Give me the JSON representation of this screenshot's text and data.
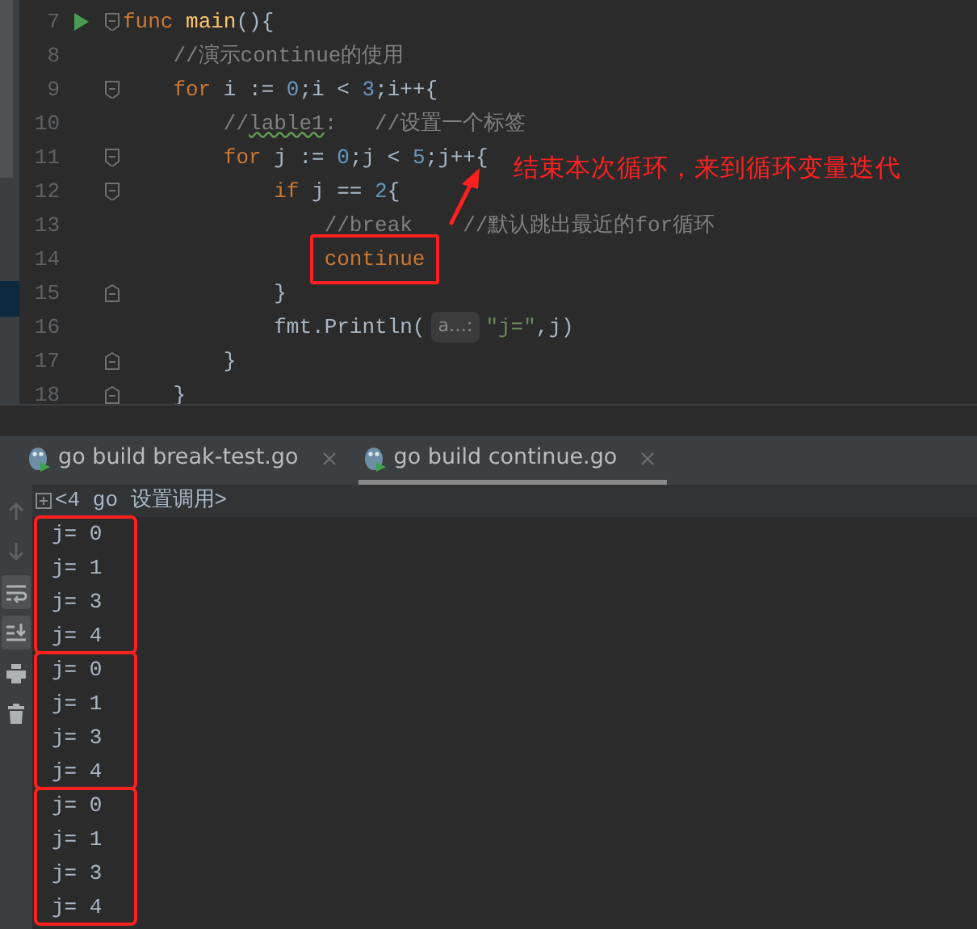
{
  "editor": {
    "lines": [
      {
        "number": "7",
        "run": true,
        "fold_start": true,
        "fold_end": false,
        "boxed": false,
        "tokens": [
          {
            "kind": "kw",
            "text": "func"
          },
          {
            "kind": "fn",
            "text": " main"
          },
          {
            "kind": "plain",
            "text": "(){"
          }
        ],
        "children": [
          {
            "number": "8",
            "run": false,
            "fold_start": false,
            "fold_end": false,
            "boxed": false,
            "tokens": [
              {
                "kind": "comment",
                "text": "//演示continue的使用"
              }
            ]
          },
          {
            "number": "9",
            "run": false,
            "fold_start": true,
            "fold_end": false,
            "boxed": false,
            "tokens": [
              {
                "kind": "kw",
                "text": "for"
              },
              {
                "kind": "plain",
                "text": " i := "
              },
              {
                "kind": "num",
                "text": "0"
              },
              {
                "kind": "plain",
                "text": ";i < "
              },
              {
                "kind": "num",
                "text": "3"
              },
              {
                "kind": "plain",
                "text": ";i++{"
              }
            ],
            "children": [
              {
                "number": "10",
                "run": false,
                "fold_start": false,
                "fold_end": false,
                "boxed": false,
                "tokens": [
                  {
                    "kind": "comment",
                    "text": "//"
                  },
                  {
                    "kind": "typo",
                    "text": "lable1"
                  },
                  {
                    "kind": "comment",
                    "text": ":   //设置一个标签"
                  }
                ]
              },
              {
                "number": "11",
                "run": false,
                "fold_start": true,
                "fold_end": false,
                "boxed": false,
                "tokens": [
                  {
                    "kind": "kw",
                    "text": "for"
                  },
                  {
                    "kind": "plain",
                    "text": " j := "
                  },
                  {
                    "kind": "num",
                    "text": "0"
                  },
                  {
                    "kind": "plain",
                    "text": ";j < "
                  },
                  {
                    "kind": "num",
                    "text": "5"
                  },
                  {
                    "kind": "plain",
                    "text": ";j++{"
                  }
                ],
                "children": [
                  {
                    "number": "12",
                    "run": false,
                    "fold_start": true,
                    "fold_end": false,
                    "boxed": false,
                    "tokens": [
                      {
                        "kind": "kw",
                        "text": "if"
                      },
                      {
                        "kind": "plain",
                        "text": " j == "
                      },
                      {
                        "kind": "num",
                        "text": "2"
                      },
                      {
                        "kind": "plain",
                        "text": "{"
                      }
                    ],
                    "children": [
                      {
                        "number": "13",
                        "run": false,
                        "fold_start": false,
                        "fold_end": false,
                        "boxed": false,
                        "tokens": [
                          {
                            "kind": "comment",
                            "text": "//break    //默认跳出最近的for循环"
                          }
                        ]
                      },
                      {
                        "number": "14",
                        "run": false,
                        "fold_start": false,
                        "fold_end": false,
                        "boxed": true,
                        "tokens": [
                          {
                            "kind": "kw",
                            "text": "continue"
                          }
                        ]
                      }
                    ]
                  },
                  {
                    "number": "15",
                    "run": false,
                    "fold_start": false,
                    "fold_end": true,
                    "boxed": false,
                    "tokens": [
                      {
                        "kind": "plain",
                        "text": "}"
                      }
                    ]
                  },
                  {
                    "number": "16",
                    "run": false,
                    "fold_start": false,
                    "fold_end": false,
                    "boxed": false,
                    "tokens": [
                      {
                        "kind": "plain",
                        "text": "fmt.Println("
                      },
                      {
                        "kind": "hint",
                        "text": "a…:"
                      },
                      {
                        "kind": "str",
                        "text": "\"j=\""
                      },
                      {
                        "kind": "plain",
                        "text": ",j)"
                      }
                    ]
                  }
                ]
              },
              {
                "number": "17",
                "run": false,
                "fold_start": false,
                "fold_end": true,
                "boxed": false,
                "tokens": [
                  {
                    "kind": "plain",
                    "text": "}"
                  }
                ]
              }
            ]
          },
          {
            "number": "18",
            "run": false,
            "fold_start": false,
            "fold_end": true,
            "boxed": false,
            "tokens": [
              {
                "kind": "plain",
                "text": "}"
              }
            ]
          }
        ]
      }
    ]
  },
  "annotation": {
    "text": "结束本次循环，来到循环变量迭代"
  },
  "run_tabs": [
    {
      "label": "go build break-test.go",
      "selected": false
    },
    {
      "label": "go build continue.go",
      "selected": true
    }
  ],
  "console": {
    "toolbar": [
      {
        "kind": "up",
        "disabled": true,
        "selected": false
      },
      {
        "kind": "down",
        "disabled": true,
        "selected": false
      },
      {
        "kind": "wrap",
        "disabled": false,
        "selected": true
      },
      {
        "kind": "scroll",
        "disabled": false,
        "selected": true
      },
      {
        "kind": "print",
        "disabled": false,
        "selected": false
      },
      {
        "kind": "trash",
        "disabled": false,
        "selected": false
      }
    ],
    "header": "<4 go 设置调用>",
    "groups": [
      {
        "boxed": true,
        "lines": [
          "j= 0",
          "j= 1",
          "j= 3",
          "j= 4"
        ]
      },
      {
        "boxed": true,
        "lines": [
          "j= 0",
          "j= 1",
          "j= 3",
          "j= 4"
        ]
      },
      {
        "boxed": true,
        "lines": [
          "j= 0",
          "j= 1",
          "j= 3",
          "j= 4"
        ]
      }
    ]
  }
}
